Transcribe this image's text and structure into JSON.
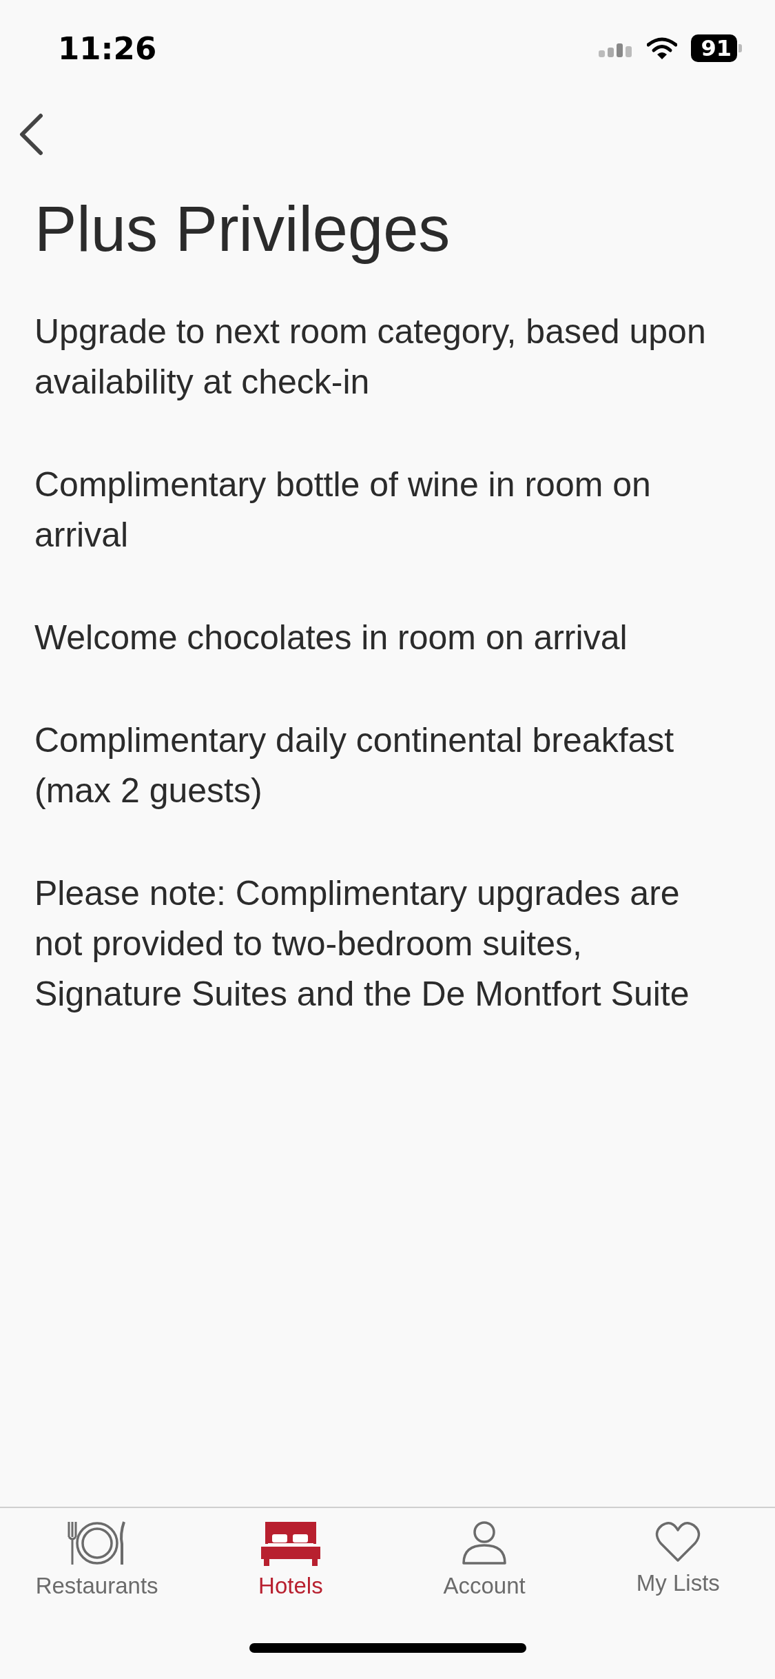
{
  "status_bar": {
    "time": "11:26",
    "battery": "91"
  },
  "title": "Plus Privileges",
  "paragraphs": [
    "Upgrade to next room category, based upon availability at check-in",
    "Complimentary bottle of wine in room on arrival",
    "Welcome chocolates in room on arrival",
    "Complimentary daily continental breakfast (max 2 guests)",
    "Please note: Complimentary upgrades are not provided to two-bedroom suites, Signature Suites and the De Montfort Suite"
  ],
  "tab_bar": [
    {
      "kind": "restaurants",
      "label": "Restaurants",
      "selected": false
    },
    {
      "kind": "hotels",
      "label": "Hotels",
      "selected": true
    },
    {
      "kind": "account",
      "label": "Account",
      "selected": false
    },
    {
      "kind": "lists",
      "label": "My Lists",
      "selected": false
    }
  ]
}
